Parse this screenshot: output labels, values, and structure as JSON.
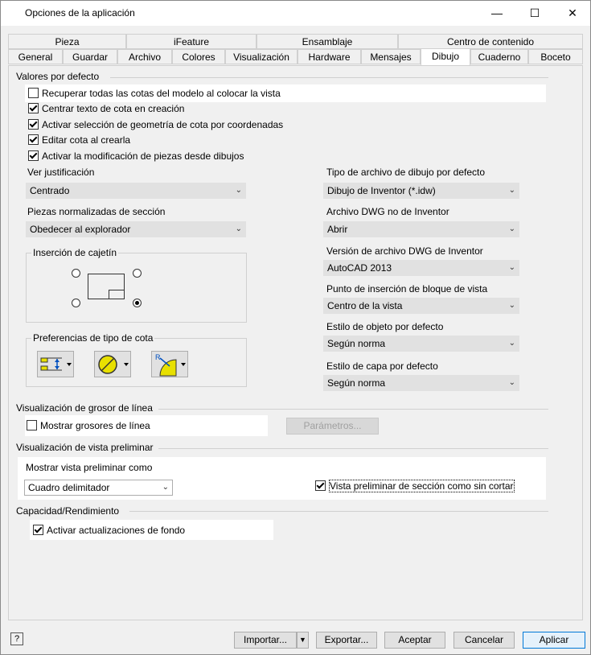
{
  "window": {
    "title": "Opciones de la aplicación",
    "minimize": "—",
    "maximize": "☐",
    "close": "✕"
  },
  "tabs": {
    "row1": [
      "Pieza",
      "iFeature",
      "Ensamblaje",
      "Centro de contenido"
    ],
    "row2": [
      "General",
      "Guardar",
      "Archivo",
      "Colores",
      "Visualización",
      "Hardware",
      "Mensajes",
      "Dibujo",
      "Cuaderno",
      "Boceto"
    ],
    "active": "Dibujo"
  },
  "defaults": {
    "section": "Valores por defecto",
    "checkboxes": [
      {
        "label": "Recuperar todas las cotas del modelo al colocar la vista",
        "checked": false
      },
      {
        "label": "Centrar texto de cota en creación",
        "checked": true
      },
      {
        "label": "Activar selección de geometría de cota por coordenadas",
        "checked": true
      },
      {
        "label": "Editar cota al crearla",
        "checked": true
      },
      {
        "label": "Activar la modificación de piezas desde dibujos",
        "checked": true
      }
    ],
    "justification_label": "Ver justificación",
    "justification_value": "Centrado",
    "section_parts_label": "Piezas normalizadas de sección",
    "section_parts_value": "Obedecer al explorador",
    "title_block_label": "Inserción de cajetín",
    "dim_prefs_label": "Preferencias de tipo de cota",
    "drawing_type_label": "Tipo de archivo de dibujo por defecto",
    "drawing_type_value": "Dibujo de Inventor (*.idw)",
    "dwg_label": "Archivo DWG no de Inventor",
    "dwg_value": "Abrir",
    "dwg_version_label": "Versión de archivo DWG de Inventor",
    "dwg_version_value": "AutoCAD 2013",
    "insert_point_label": "Punto de inserción de bloque de vista",
    "insert_point_value": "Centro de la vista",
    "object_style_label": "Estilo de objeto por defecto",
    "object_style_value": "Según norma",
    "layer_style_label": "Estilo de capa por defecto",
    "layer_style_value": "Según norma"
  },
  "lineweight": {
    "section": "Visualización de grosor de línea",
    "checkbox_label": "Mostrar grosores de línea",
    "checked": false,
    "settings_button": "Parámetros..."
  },
  "preview": {
    "section": "Visualización de vista preliminar",
    "show_as_label": "Mostrar vista preliminar como",
    "show_as_value": "Cuadro delimitador",
    "uncut_label": "Vista preliminar de sección como sin cortar",
    "uncut_checked": true
  },
  "performance": {
    "section": "Capacidad/Rendimiento",
    "background_label": "Activar actualizaciones de fondo",
    "background_checked": true
  },
  "footer": {
    "help": "?",
    "import": "Importar...",
    "export": "Exportar...",
    "accept": "Aceptar",
    "cancel": "Cancelar",
    "apply": "Aplicar"
  }
}
